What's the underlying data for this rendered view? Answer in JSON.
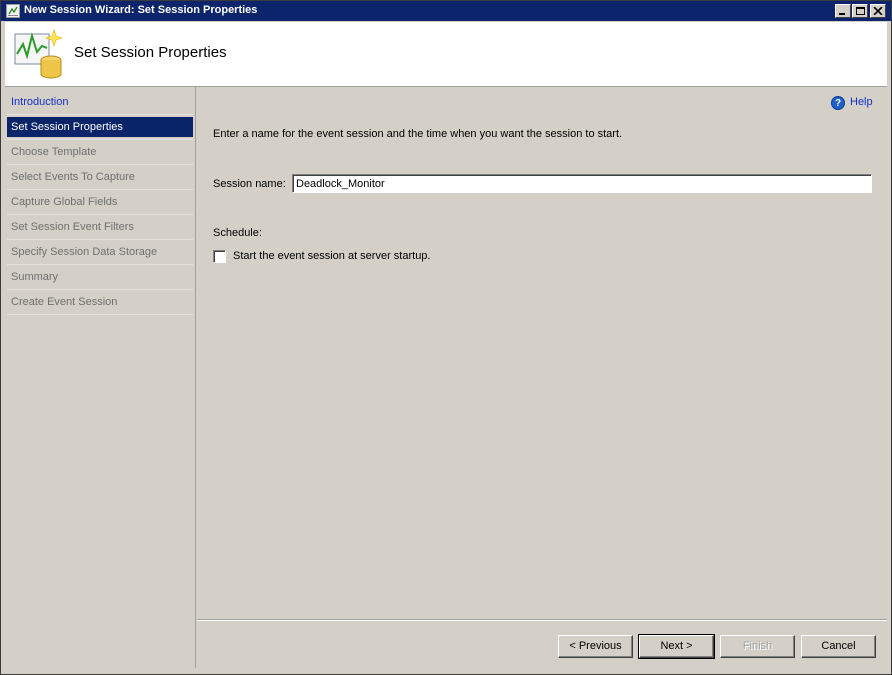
{
  "window": {
    "title": "New Session Wizard: Set Session Properties"
  },
  "banner": {
    "title": "Set Session Properties",
    "icon": "session-chart-database-icon"
  },
  "nav": {
    "items": [
      {
        "label": "Introduction",
        "state": "link"
      },
      {
        "label": "Set Session Properties",
        "state": "selected"
      },
      {
        "label": "Choose Template",
        "state": "disabled"
      },
      {
        "label": "Select Events To Capture",
        "state": "disabled"
      },
      {
        "label": "Capture Global Fields",
        "state": "disabled"
      },
      {
        "label": "Set Session Event Filters",
        "state": "disabled"
      },
      {
        "label": "Specify Session Data Storage",
        "state": "disabled"
      },
      {
        "label": "Summary",
        "state": "disabled"
      },
      {
        "label": "Create Event Session",
        "state": "disabled"
      }
    ]
  },
  "help": {
    "label": "Help",
    "icon": "help-icon"
  },
  "form": {
    "instructions": "Enter a name for the event session and the time when you want the session to start.",
    "session_name_label": "Session name:",
    "session_name_value": "Deadlock_Monitor",
    "schedule_label": "Schedule:",
    "startup_checkbox_label": "Start the event session at server startup.",
    "startup_checked": false
  },
  "buttons": {
    "previous": {
      "label": "< Previous",
      "enabled": true
    },
    "next": {
      "label": "Next >",
      "enabled": true
    },
    "finish": {
      "label": "Finish",
      "enabled": false
    },
    "cancel": {
      "label": "Cancel",
      "enabled": true
    }
  },
  "colors": {
    "titlebar": "#0b246b",
    "selected_nav": "#0a246a",
    "link": "#1531c9",
    "dialog_bg": "#d4d0c8"
  }
}
